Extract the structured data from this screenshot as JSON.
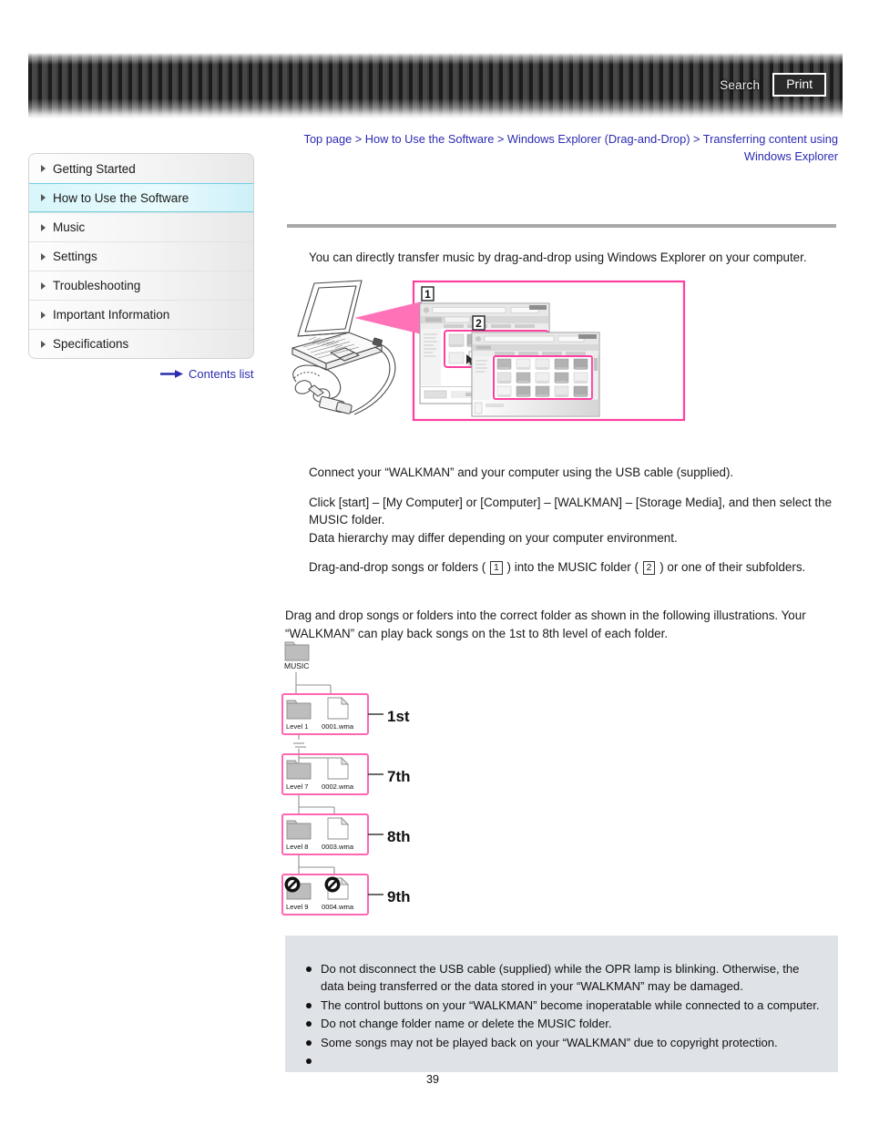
{
  "header": {
    "search_label": "Search",
    "print_label": "Print",
    "search_icon": "search-icon",
    "print_icon": "print-icon"
  },
  "breadcrumb": {
    "text": "Top page > How to Use the Software > Windows Explorer (Drag-and-Drop) > Transferring content using Windows Explorer",
    "color": "#2b2bb0"
  },
  "sidebar": {
    "items": [
      {
        "label": "Getting Started",
        "selected": false
      },
      {
        "label": "How to Use the Software",
        "selected": true
      },
      {
        "label": "Music",
        "selected": false
      },
      {
        "label": "Settings",
        "selected": false
      },
      {
        "label": "Troubleshooting",
        "selected": false
      },
      {
        "label": "Important Information",
        "selected": false
      },
      {
        "label": "Specifications",
        "selected": false
      }
    ],
    "contents_list_label": "Contents list",
    "contents_list_icon": "right-arrow-icon",
    "selected_color": "#6fcfe4"
  },
  "main": {
    "intro": "You can directly transfer music by drag-and-drop using Windows Explorer on your computer.",
    "figure_transfer": {
      "name": "drag-and-drop-transfer-illustration",
      "laptop_label": "laptop-with-usb-cable-and-walkman",
      "window_1_badge": "1",
      "window_2_badge": "2",
      "accent_color": "#ff3fa0"
    },
    "steps": [
      {
        "id": "step-connect",
        "lines": [
          "Connect your “WALKMAN” and your computer using the USB cable (supplied)."
        ]
      },
      {
        "id": "step-click",
        "lines": [
          "Click [start] – [My Computer] or [Computer] – [WALKMAN] – [Storage Media], and then select the MUSIC folder.",
          "Data hierarchy may differ depending on your computer environment."
        ]
      },
      {
        "id": "step-drag",
        "prefix": "Drag-and-drop songs or folders ( ",
        "badge1": "1",
        "middle": " ) into the MUSIC folder ( ",
        "badge2": "2",
        "suffix": " ) or one of their subfolders."
      }
    ],
    "hierarchy_text": "Drag and drop songs or folders into the correct folder as shown in the following illustrations. Your “WALKMAN” can play back songs on the 1st to 8th level of each folder.",
    "hierarchy": {
      "root_label": "MUSIC",
      "levels": [
        {
          "folder": "Level 1",
          "file": "0001.wma",
          "ordinal": "1st",
          "blocked": false
        },
        {
          "folder": "Level 7",
          "file": "0002.wma",
          "ordinal": "7th",
          "blocked": false
        },
        {
          "folder": "Level 8",
          "file": "0003.wma",
          "ordinal": "8th",
          "blocked": false
        },
        {
          "folder": "Level 9",
          "file": "0004.wma",
          "ordinal": "9th",
          "blocked": true
        }
      ],
      "highlight_color": "#ff66b2"
    },
    "notes": [
      "Do not disconnect the USB cable (supplied) while the OPR lamp is blinking. Otherwise, the data being transferred or the data stored in your “WALKMAN” may be damaged.",
      "The control buttons on your “WALKMAN” become inoperatable while connected to a computer.",
      "Do not change folder name or delete the MUSIC folder.",
      "Some songs may not be played back on your “WALKMAN” due to copyright protection.",
      ""
    ],
    "page_number": "39"
  }
}
